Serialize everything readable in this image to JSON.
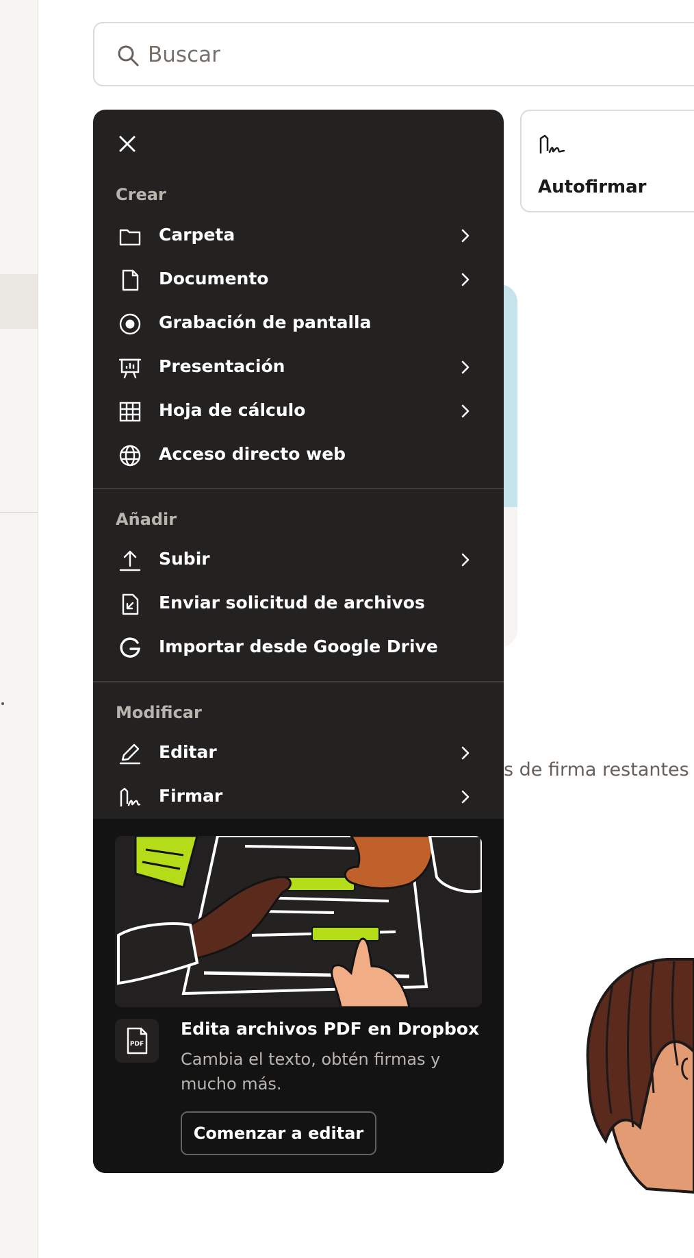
{
  "search": {
    "placeholder": "Buscar"
  },
  "quick_action": {
    "label": "Autofirmar"
  },
  "background_text": "s de firma restantes e",
  "menu": {
    "sections": [
      {
        "title": "Crear",
        "items": [
          {
            "label": "Carpeta",
            "icon": "folder-icon",
            "has_submenu": true
          },
          {
            "label": "Documento",
            "icon": "document-icon",
            "has_submenu": true
          },
          {
            "label": "Grabación de pantalla",
            "icon": "record-icon",
            "has_submenu": false
          },
          {
            "label": "Presentación",
            "icon": "presentation-icon",
            "has_submenu": true
          },
          {
            "label": "Hoja de cálculo",
            "icon": "spreadsheet-icon",
            "has_submenu": true
          },
          {
            "label": "Acceso directo web",
            "icon": "globe-icon",
            "has_submenu": false
          }
        ]
      },
      {
        "title": "Añadir",
        "items": [
          {
            "label": "Subir",
            "icon": "upload-icon",
            "has_submenu": true
          },
          {
            "label": "Enviar solicitud de archivos",
            "icon": "file-request-icon",
            "has_submenu": false
          },
          {
            "label": "Importar desde Google Drive",
            "icon": "google-icon",
            "has_submenu": false
          }
        ]
      },
      {
        "title": "Modificar",
        "items": [
          {
            "label": "Editar",
            "icon": "pencil-icon",
            "has_submenu": true
          },
          {
            "label": "Firmar",
            "icon": "sign-icon",
            "has_submenu": true
          }
        ]
      }
    ],
    "promo": {
      "badge_text": "PDF",
      "title": "Edita archivos PDF en Dropbox",
      "description": "Cambia el texto, obtén firmas y mucho más.",
      "button_label": "Comenzar a editar"
    }
  },
  "colors": {
    "menu_background": "#242121",
    "promo_background": "#141313",
    "accent_green": "#b4dc19",
    "card_blue": "#c4e3ea"
  }
}
